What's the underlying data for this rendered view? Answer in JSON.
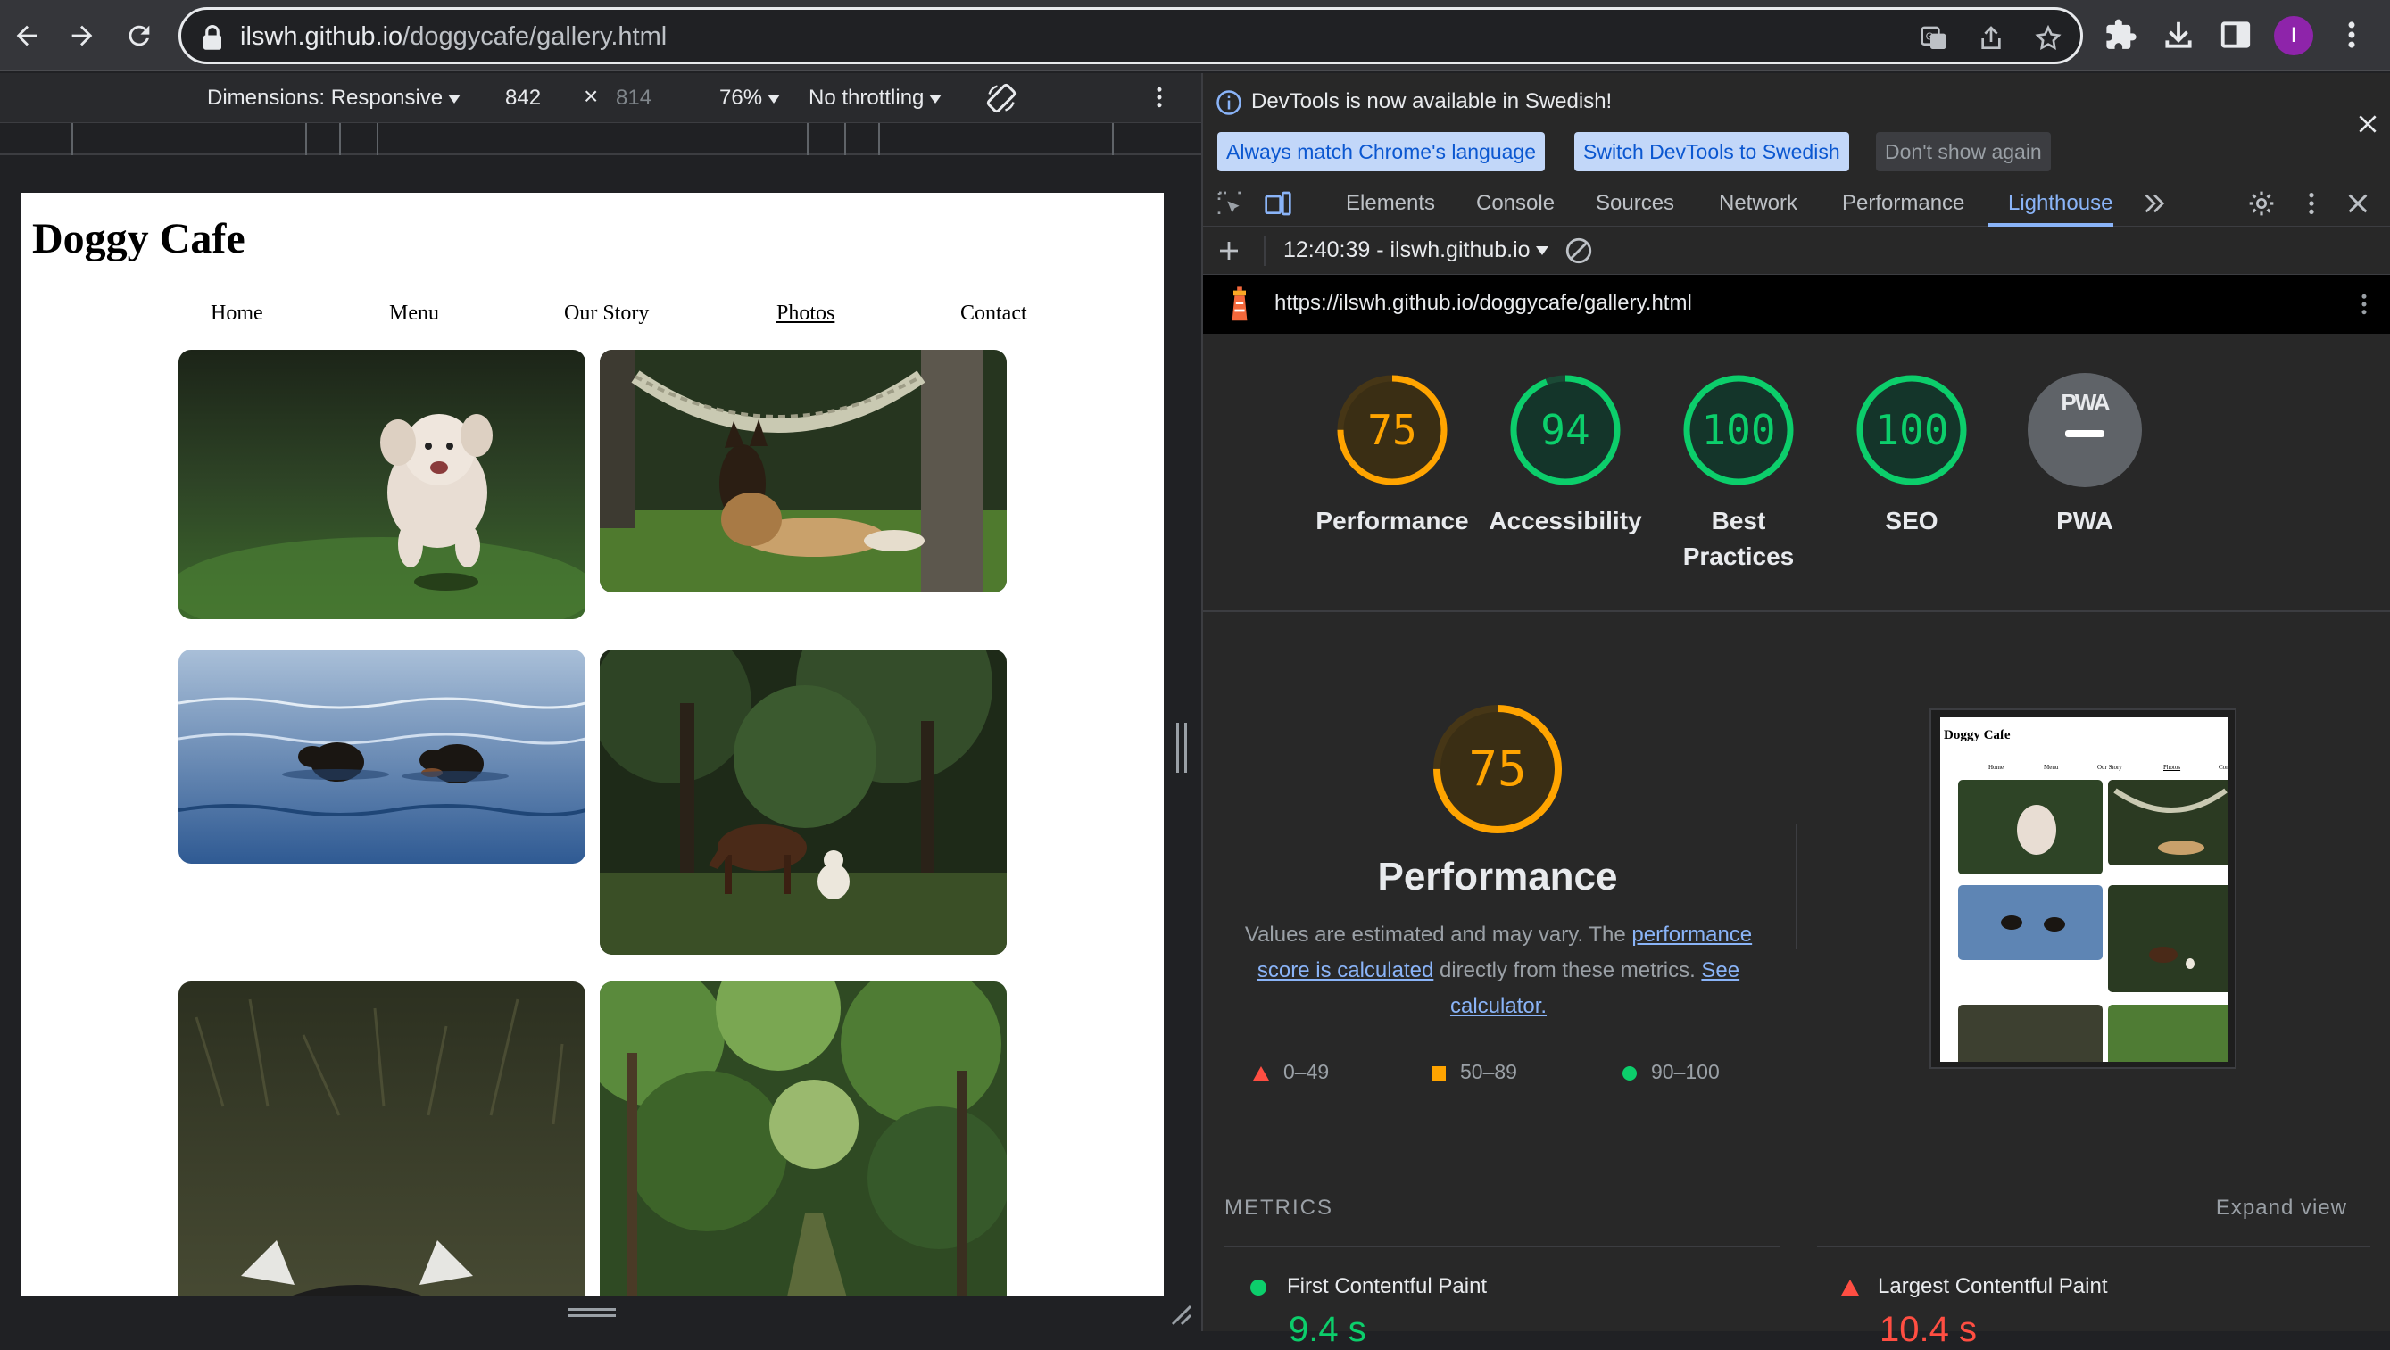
{
  "browser": {
    "url_host": "ilswh.github.io",
    "url_path": "/doggycafe/gallery.html",
    "avatar_letter": "I"
  },
  "device_toolbar": {
    "dimensions_label": "Dimensions: Responsive",
    "width": "842",
    "times": "×",
    "height": "814",
    "zoom": "76%",
    "throttling": "No throttling"
  },
  "site": {
    "title": "Doggy Cafe",
    "nav": [
      "Home",
      "Menu",
      "Our Story",
      "Photos",
      "Contact"
    ],
    "active_nav": "Photos"
  },
  "devtools": {
    "infobar_message": "DevTools is now available in Swedish!",
    "btn_match_language": "Always match Chrome's language",
    "btn_switch": "Switch DevTools to Swedish",
    "btn_dont_show": "Don't show again",
    "tabs": [
      "Elements",
      "Console",
      "Sources",
      "Network",
      "Performance",
      "Lighthouse"
    ],
    "active_tab": "Lighthouse",
    "report_select": "12:40:39 - ilswh.github.io",
    "report_url": "https://ilswh.github.io/doggycafe/gallery.html"
  },
  "lighthouse": {
    "scores": [
      {
        "label": "Performance",
        "value": "75",
        "score": 75,
        "color": "#ffa400"
      },
      {
        "label": "Accessibility",
        "value": "94",
        "score": 94,
        "color": "#0cce6b"
      },
      {
        "label": "Best Practices",
        "value": "100",
        "score": 100,
        "color": "#0cce6b"
      },
      {
        "label": "SEO",
        "value": "100",
        "score": 100,
        "color": "#0cce6b"
      },
      {
        "label": "PWA",
        "value": "PWA",
        "color": "#9aa0a6"
      }
    ],
    "perf_score": "75",
    "perf_title": "Performance",
    "desc_prefix": "Values are estimated and may vary. The ",
    "desc_link1": "performance score is calculated",
    "desc_middle": " directly from these metrics. ",
    "desc_link2": "See calculator.",
    "legend": [
      "0–49",
      "50–89",
      "90–100"
    ],
    "metrics_heading": "METRICS",
    "expand_view": "Expand view",
    "metrics": [
      {
        "name": "First Contentful Paint",
        "value": "9.4 s",
        "status": "pass"
      },
      {
        "name": "Largest Contentful Paint",
        "value": "10.4 s",
        "status": "fail"
      }
    ]
  },
  "colors": {
    "accent": "#8ab4f8",
    "average": "#ffa400",
    "pass": "#0cce6b",
    "fail": "#ff4e42"
  }
}
